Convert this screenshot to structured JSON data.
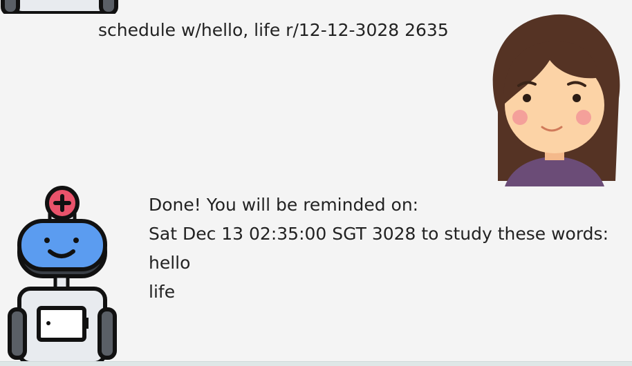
{
  "conversation": {
    "user_message": "schedule w/hello, life r/12-12-3028 2635",
    "bot_message_lines": [
      "Done! You will be reminded on:",
      "Sat Dec 13 02:35:00 SGT 3028 to study these words:",
      "hello",
      "life"
    ]
  },
  "avatars": {
    "user_icon": "woman-avatar-icon",
    "bot_icon": "robot-avatar-icon"
  },
  "colors": {
    "background": "#f4f4f4",
    "robot_head": "#5b9cf0",
    "robot_badge": "#e9536b",
    "hair": "#553324",
    "skin": "#fcd3a6",
    "shirt": "#6b4c77"
  }
}
